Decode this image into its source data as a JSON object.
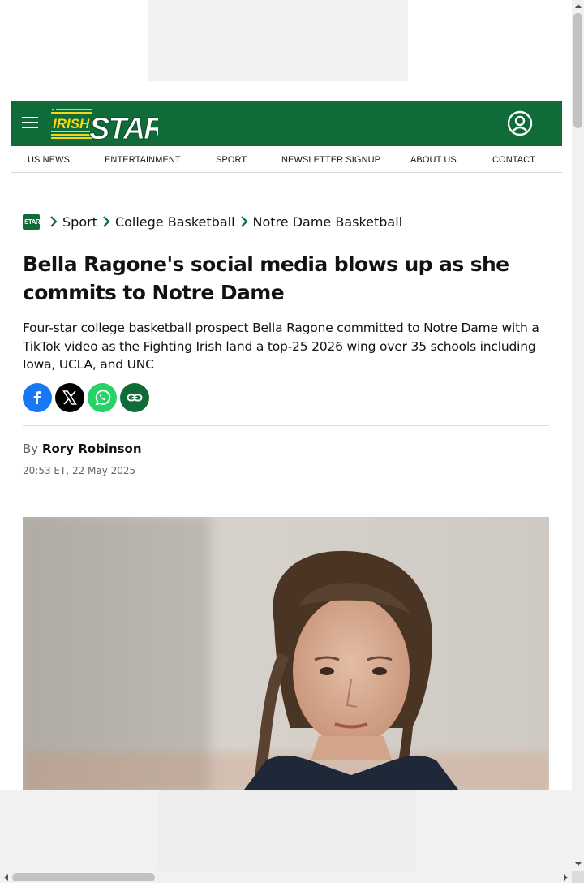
{
  "colors": {
    "brand_green": "#0f6b38",
    "logo_yellow": "#f7d417",
    "facebook": "#1877f2",
    "x": "#000000",
    "whatsapp": "#25d366",
    "copy_link": "#0f6b38"
  },
  "header": {
    "logo_text_small": "IRISH",
    "logo_text_large": "STAR",
    "menu_icon": "hamburger-icon",
    "account_icon": "user-circle-icon"
  },
  "nav": {
    "items": [
      {
        "label": "US NEWS"
      },
      {
        "label": "ENTERTAINMENT"
      },
      {
        "label": "SPORT"
      },
      {
        "label": "NEWSLETTER SIGNUP"
      },
      {
        "label": "ABOUT US"
      },
      {
        "label": "CONTACT"
      }
    ]
  },
  "breadcrumb": {
    "home_icon_label": "STAR",
    "items": [
      {
        "label": "Sport"
      },
      {
        "label": "College Basketball"
      },
      {
        "label": "Notre Dame Basketball"
      }
    ]
  },
  "article": {
    "headline": "Bella Ragone's social media blows up as she commits to Notre Dame",
    "standfirst": "Four-star college basketball prospect Bella Ragone committed to Notre Dame with a TikTok video as the Fighting Irish land a top-25 2026 wing over 35 schools including Iowa, UCLA, and UNC",
    "byline_prefix": "By",
    "author": "Rory Robinson",
    "date": "20:53 ET, 22 May 2025"
  },
  "share": {
    "buttons": [
      {
        "icon": "facebook-icon"
      },
      {
        "icon": "x-icon"
      },
      {
        "icon": "whatsapp-icon"
      },
      {
        "icon": "link-icon"
      }
    ]
  }
}
